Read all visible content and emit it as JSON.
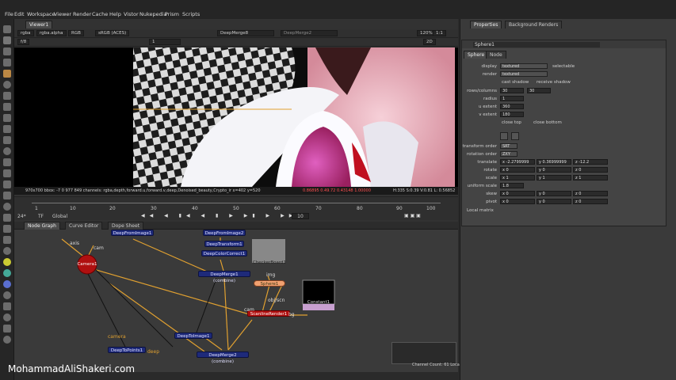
{
  "menu": [
    "File",
    "Edit",
    "Workspace",
    "Viewer",
    "Render",
    "Cache",
    "Help",
    "Vistor",
    "Nukepedia",
    "Prism",
    "Scripts"
  ],
  "viewer": {
    "tab": "Viewer1",
    "channels": "rgba",
    "alpha": "rgba.alpha",
    "rgb": "RGB",
    "colorspace": "sRGB (ACES)",
    "input_a": "DeepMerge8",
    "input_b": "DeepMerge2",
    "zoom": "120%",
    "ratio": "1:1",
    "mode": "2D",
    "frame_field": "1",
    "frame_counter": "f/8",
    "info_left": "970x700  bbox: -7 0 977 849 channels: rgba,depth,forward.u,forward.v,deep,Denoised_beauty,Crypto_ir  x=402 y=520",
    "info_values": "0.86895  0.49.72  0.43148  1.00000",
    "info_hsv": "H:335 S:0.39 V:0.81  L: 0.56852"
  },
  "timeline": {
    "fps": "24*",
    "tf": "TF",
    "global": "Global",
    "ticks": [
      "1",
      "10",
      "20",
      "30",
      "40",
      "50",
      "60",
      "70",
      "80",
      "90",
      "100"
    ],
    "end": "100",
    "start_field": "1",
    "step_field": "10",
    "end_field": "100"
  },
  "nodegraph": {
    "tabs": [
      "Node Graph",
      "Curve Editor",
      "Dope Sheet"
    ],
    "nodes": {
      "deep_from_image1": "DeepFromImage1",
      "deep_from_image2": "DeepFromImage2",
      "deep_transform1": "DeepTransform1",
      "deep_color_correct1": "DeepColorCorrect1",
      "deep_merge1": "DeepMerge1 (combine)",
      "deep_merge2": "DeepMerge2 (combine)",
      "deep_to_image1": "DeepToImage1",
      "deep_to_points1": "DeepToPoints1",
      "camera1": "Camera1",
      "sphere1": "Sphere1",
      "checkerboard1": "CheckerBoard1",
      "scanline_render1": "ScanlineRender1",
      "constant1": "Constant1",
      "img_label": "img",
      "obj_label": "obj/scn",
      "cam_label": "cam",
      "camera_label": "camera",
      "deep_label": "deep",
      "axis_label": "axis",
      "cam_label2": "cam",
      "bg_label": "bg"
    },
    "status": "Channel Count: 61  Localization Mode: On  Memory: 5.5 GB (17.1%)  CPU: 3.1%  Disk: 0.0 MB/s  Network: 0.0 MB/s"
  },
  "properties": {
    "tabs": [
      "Properties",
      "Background Renders"
    ],
    "node_name": "Sphere1",
    "subtabs": [
      "Sphere",
      "Node"
    ],
    "display_label": "display",
    "display_value": "textured",
    "selectable": "selectable",
    "render_label": "render",
    "render_value": "textured",
    "cast_shadow": "cast shadow",
    "receive_shadow": "receive shadow",
    "rows_label": "rows/columns",
    "rows": "30",
    "cols": "30",
    "radius_label": "radius",
    "radius": "1",
    "uext_label": "u extent",
    "uext": "360",
    "vext_label": "v extent",
    "vext": "180",
    "close_top": "close top",
    "close_bottom": "close bottom",
    "transform_order_label": "transform order",
    "transform_order": "SRT",
    "rotation_order_label": "rotation order",
    "rotation_order": "ZXY",
    "translate_label": "translate",
    "translate_x": "x -2.2799999",
    "translate_y": "y 0.36999999",
    "translate_z": "z -12.2",
    "rotate_label": "rotate",
    "rotate_x": "x 0",
    "rotate_y": "y 0",
    "rotate_z": "z 0",
    "scale_label": "scale",
    "scale_x": "x 1",
    "scale_y": "y 1",
    "scale_z": "z 1",
    "uniform_scale_label": "uniform scale",
    "uniform_scale": "1.8",
    "skew_label": "skew",
    "skew_x": "x 0",
    "skew_y": "y 0",
    "skew_z": "z 0",
    "pivot_label": "pivot",
    "pivot_x": "x 0",
    "pivot_y": "y 0",
    "pivot_z": "z 0",
    "local_matrix": "Local matrix"
  },
  "watermark": "MohammadAliShakeri.com",
  "colors": {
    "node_deep": "#1e2a7a",
    "camera": "#b01010",
    "sphere": "#f0a070",
    "link": "#e0a030"
  }
}
